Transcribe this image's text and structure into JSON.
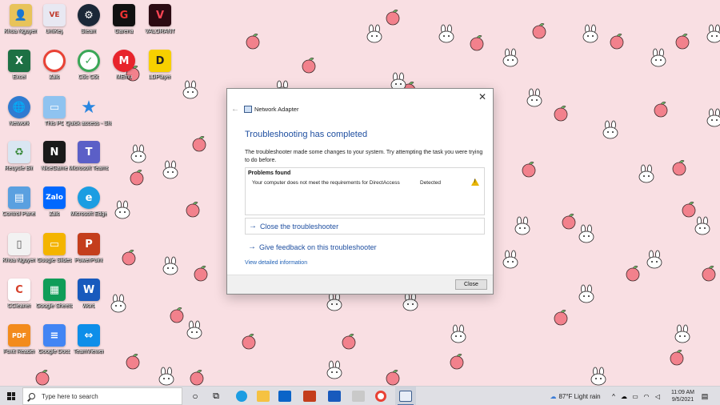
{
  "desktop": {
    "icons": [
      {
        "label": "Khoa Nguyen"
      },
      {
        "label": "UniKey"
      },
      {
        "label": "Steam"
      },
      {
        "label": "Garena"
      },
      {
        "label": "VALORANT"
      },
      {
        "label": "Excel"
      },
      {
        "label": "Zalo"
      },
      {
        "label": "Cốc Cốc"
      },
      {
        "label": "MEmu"
      },
      {
        "label": "LDPlayer"
      },
      {
        "label": "Network"
      },
      {
        "label": "This PC"
      },
      {
        "label": "Quick access - Shortcut"
      },
      {
        "label": "Recycle Bin"
      },
      {
        "label": "NiceGame"
      },
      {
        "label": "Microsoft Teams"
      },
      {
        "label": "Control Panel"
      },
      {
        "label": "Zalo"
      },
      {
        "label": "Microsoft Edge"
      },
      {
        "label": "Khoa Nguyen"
      },
      {
        "label": "Google Slides"
      },
      {
        "label": "PowerPoint"
      },
      {
        "label": "CCleaner"
      },
      {
        "label": "Google Sheets"
      },
      {
        "label": "Word"
      },
      {
        "label": "Foxit Reader"
      },
      {
        "label": "Google Docs"
      },
      {
        "label": "TeamViewer"
      }
    ]
  },
  "dialog": {
    "app_title": "Network Adapter",
    "heading": "Troubleshooting has completed",
    "description": "The troubleshooter made some changes to your system. Try attempting the task you were trying to do before.",
    "problems": {
      "title": "Problems found",
      "item": "Your computer does not meet the requirements for DirectAccess",
      "status": "Detected"
    },
    "close_troubleshooter": "Close the troubleshooter",
    "give_feedback": "Give feedback on this troubleshooter",
    "view_details": "View detailed information",
    "close_button": "Close",
    "close_x": "✕",
    "back_arrow": "←",
    "cmd_arrow": "→"
  },
  "taskbar": {
    "search_placeholder": "Type here to search",
    "weather": "87°F  Light rain",
    "time": "11:09 AM",
    "date": "9/5/2021",
    "task_view_glyph": "⧉",
    "cortana_glyph": "○",
    "tray_chevron": "^"
  },
  "colors": {
    "wallpaper": "#f9dfe3",
    "accent_blue": "#1f4fa0",
    "warning": "#e8b500",
    "taskbar": "#dfdfe4"
  }
}
